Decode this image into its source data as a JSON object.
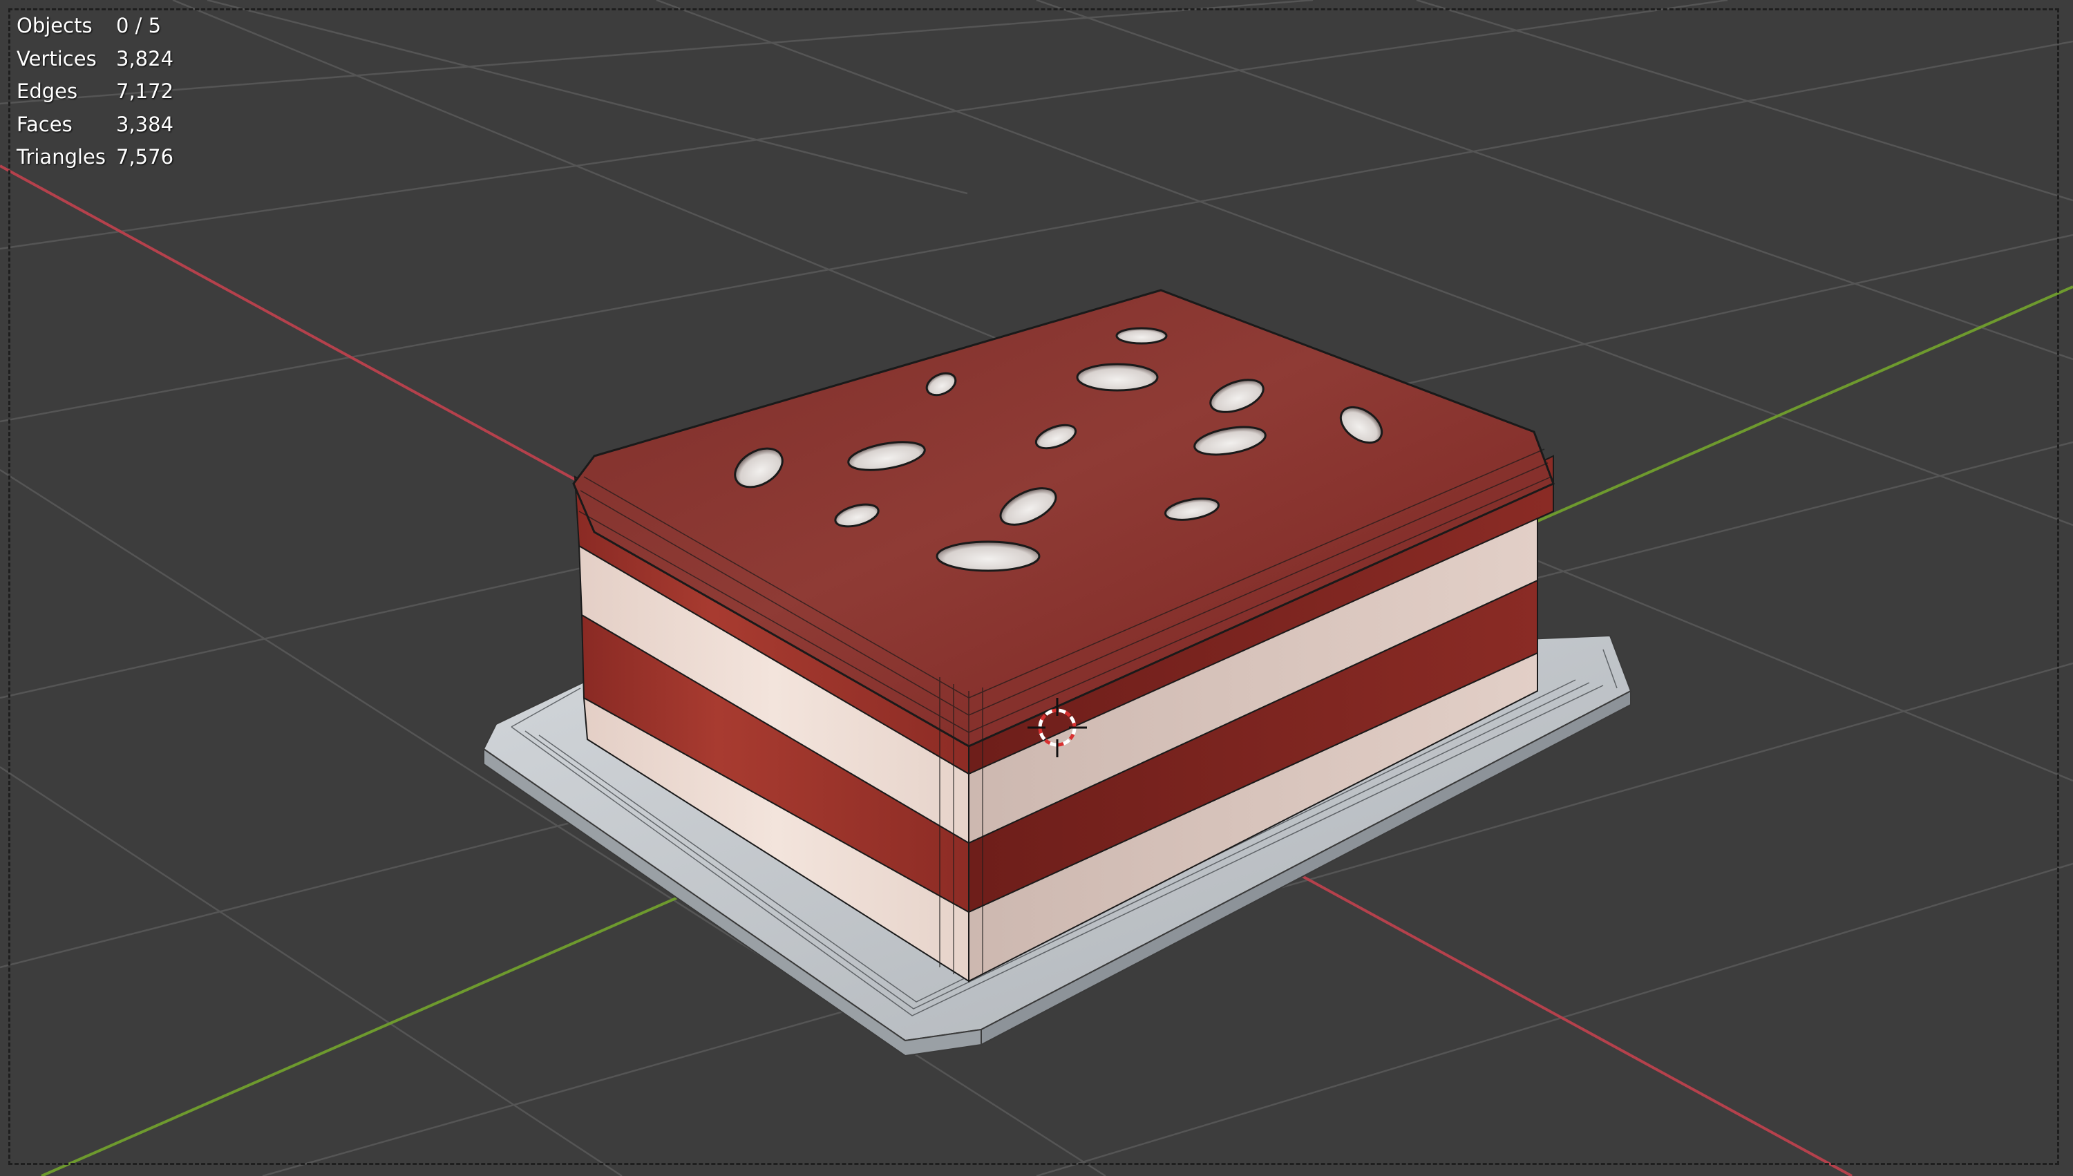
{
  "viewport": {
    "name": "3D Viewport",
    "background_color": "#3d3d3d",
    "grid_color": "#545454",
    "x_axis_color": "#b5414c",
    "y_axis_color": "#6e9a2e"
  },
  "statistics": [
    {
      "label": "Objects",
      "value": "0 / 5"
    },
    {
      "label": "Vertices",
      "value": "3,824"
    },
    {
      "label": "Edges",
      "value": "7,172"
    },
    {
      "label": "Faces",
      "value": "3,384"
    },
    {
      "label": "Triangles",
      "value": "7,576"
    }
  ],
  "model": {
    "description": "layered cake on a tray",
    "layers": [
      "tray",
      "cream",
      "sponge",
      "cream",
      "top"
    ],
    "colors": {
      "sponge": "#8e2a24",
      "sponge_light": "#b24a40",
      "cream": "#e9d6cc",
      "tray": "#c9ced2",
      "wire": "#1a1a1a"
    }
  },
  "cursor": {
    "icon": "3d-cursor-icon",
    "colors": [
      "#ffffff",
      "#d83030"
    ]
  }
}
